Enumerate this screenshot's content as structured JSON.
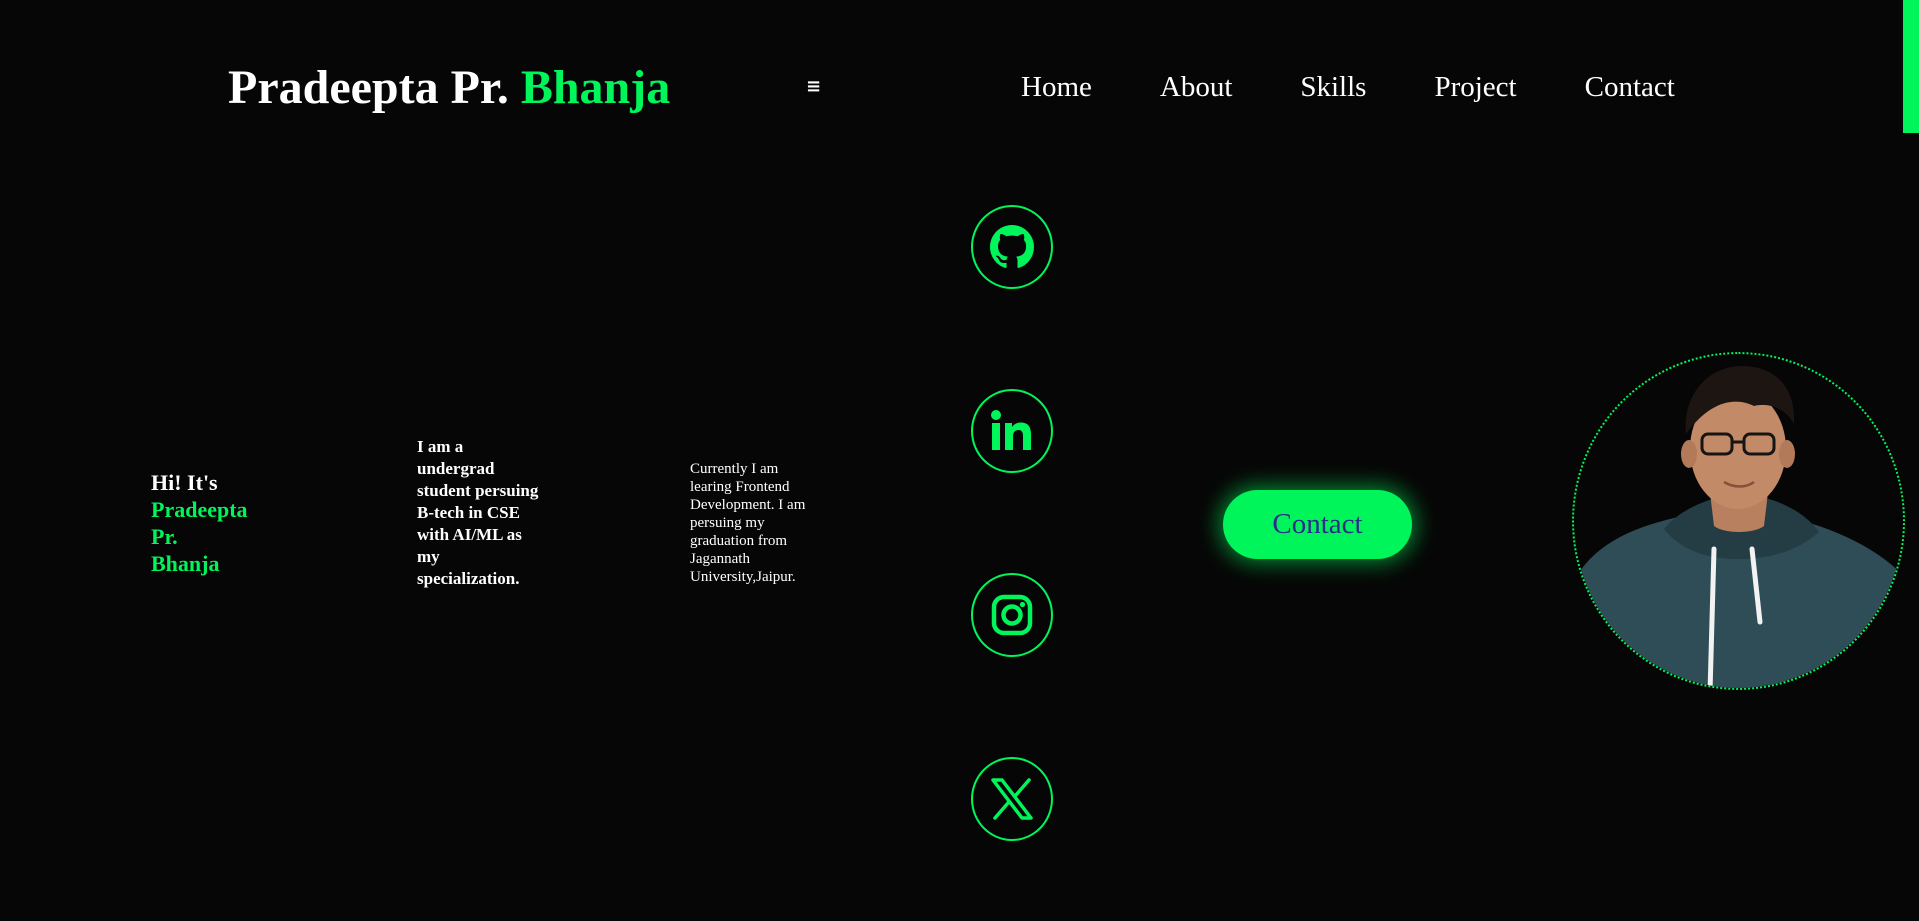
{
  "header": {
    "logo_first": "Pradeepta Pr.",
    "logo_accent": "Bhanja",
    "menu_icon": "≡",
    "nav": [
      "Home",
      "About",
      "Skills",
      "Project",
      "Contact"
    ]
  },
  "hero": {
    "greeting": "Hi! It's",
    "name_lines": [
      "Pradeepta",
      "Pr.",
      "Bhanja"
    ],
    "intro": "I am a undergrad student persuing B-tech in CSE with AI/ML as my specialization.",
    "current": "Currently I am learing Frontend Development. I am persuing my graduation from Jagannath University,Jaipur."
  },
  "social": [
    {
      "name": "github",
      "icon": "github-icon"
    },
    {
      "name": "linkedin",
      "icon": "linkedin-icon"
    },
    {
      "name": "instagram",
      "icon": "instagram-icon"
    },
    {
      "name": "x",
      "icon": "x-icon"
    }
  ],
  "cta": {
    "contact_label": "Contact"
  },
  "colors": {
    "background": "#060606",
    "accent": "#00f55a",
    "button_text": "#2b2d8a",
    "text": "#ffffff"
  }
}
